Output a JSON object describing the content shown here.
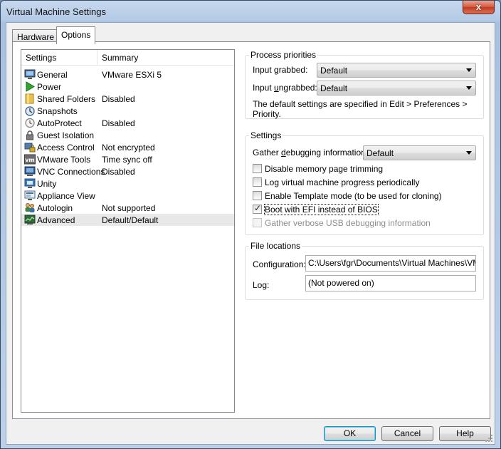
{
  "window": {
    "title": "Virtual Machine Settings",
    "close_glyph": "x"
  },
  "tabs": [
    {
      "label": "Hardware",
      "active": false
    },
    {
      "label": "Options",
      "active": true
    }
  ],
  "list": {
    "col_settings": "Settings",
    "col_summary": "Summary",
    "items": [
      {
        "name": "General",
        "summary": "VMware ESXi 5",
        "icon": "monitor-icon"
      },
      {
        "name": "Power",
        "summary": "",
        "icon": "play-icon"
      },
      {
        "name": "Shared Folders",
        "summary": "Disabled",
        "icon": "folder-icon"
      },
      {
        "name": "Snapshots",
        "summary": "",
        "icon": "snapshot-icon"
      },
      {
        "name": "AutoProtect",
        "summary": "Disabled",
        "icon": "clock-icon"
      },
      {
        "name": "Guest Isolation",
        "summary": "",
        "icon": "lock-icon"
      },
      {
        "name": "Access Control",
        "summary": "Not encrypted",
        "icon": "access-control-icon"
      },
      {
        "name": "VMware Tools",
        "summary": "Time sync off",
        "icon": "vm-icon"
      },
      {
        "name": "VNC Connections",
        "summary": "Disabled",
        "icon": "vnc-icon"
      },
      {
        "name": "Unity",
        "summary": "",
        "icon": "unity-icon"
      },
      {
        "name": "Appliance View",
        "summary": "",
        "icon": "appliance-icon"
      },
      {
        "name": "Autologin",
        "summary": "Not supported",
        "icon": "users-icon"
      },
      {
        "name": "Advanced",
        "summary": "Default/Default",
        "icon": "advanced-icon",
        "selected": true
      }
    ]
  },
  "process_priorities": {
    "title": "Process priorities",
    "grabbed_label": "Input grabbed:",
    "grabbed_value": "Default",
    "ungrabbed_label": "Input ungrabbed:",
    "ungrabbed_value": "Default",
    "note_line1": "The default settings are specified in Edit > Preferences >",
    "note_line2": "Priority."
  },
  "settings": {
    "title": "Settings",
    "debug_label": "Gather debugging information:",
    "debug_value": "Default",
    "checks": [
      {
        "label": "Disable memory page trimming",
        "checked": false,
        "disabled": false
      },
      {
        "label": "Log virtual machine progress periodically",
        "checked": false,
        "disabled": false
      },
      {
        "label": "Enable Template mode (to be used for cloning)",
        "checked": false,
        "disabled": false
      },
      {
        "label": "Boot with EFI instead of BIOS",
        "checked": true,
        "disabled": false
      },
      {
        "label": "Gather verbose USB debugging information",
        "checked": false,
        "disabled": true
      }
    ]
  },
  "file_locations": {
    "title": "File locations",
    "config_label": "Configuration:",
    "config_value": "C:\\Users\\fgr\\Documents\\Virtual Machines\\VMware",
    "log_label": "Log:",
    "log_value": "(Not powered on)"
  },
  "buttons": {
    "ok": "OK",
    "cancel": "Cancel",
    "help": "Help"
  },
  "colors": {
    "accent_selection": "#e8e8e8",
    "default_button_border": "#3c7fb1"
  }
}
